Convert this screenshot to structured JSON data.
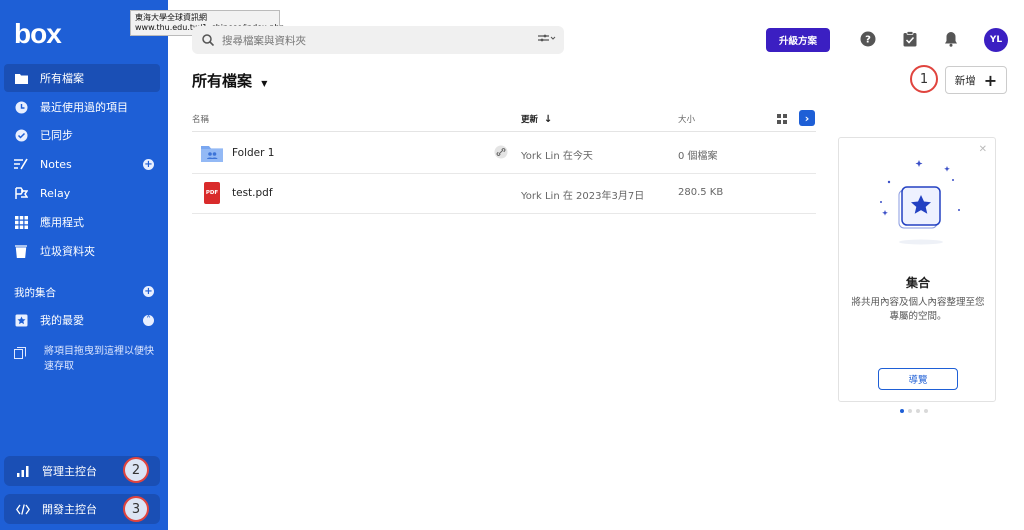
{
  "brand": {
    "logo_text": "box"
  },
  "tooltip": {
    "line1": "東海大學全球資訊網",
    "line2": "www.thu.edu.tw/1_chinese/index.php"
  },
  "sidebar": {
    "items": [
      {
        "label": "所有檔案",
        "icon": "folder-icon"
      },
      {
        "label": "最近使用過的項目",
        "icon": "clock-icon"
      },
      {
        "label": "已同步",
        "icon": "check-circle-icon"
      },
      {
        "label": "Notes",
        "icon": "notes-icon"
      },
      {
        "label": "Relay",
        "icon": "relay-icon"
      },
      {
        "label": "應用程式",
        "icon": "grid-icon"
      },
      {
        "label": "垃圾資料夾",
        "icon": "trash-icon"
      }
    ],
    "collections_label": "我的集合",
    "favorites_label": "我的最愛",
    "drop_hint": "將項目拖曳到這裡以便快速存取",
    "admin_console": "管理主控台",
    "dev_console": "開發主控台"
  },
  "callouts": {
    "one": "1",
    "two": "2",
    "three": "3"
  },
  "header": {
    "search_placeholder": "搜尋檔案與資料夾",
    "upgrade_label": "升級方案",
    "avatar_initials": "YL"
  },
  "main": {
    "title": "所有檔案",
    "new_label": "新增",
    "columns": {
      "name": "名稱",
      "updated": "更新",
      "size": "大小"
    },
    "rows": [
      {
        "name": "Folder 1",
        "updated": "York Lin 在今天",
        "size": "0 個檔案"
      },
      {
        "name": "test.pdf",
        "updated": "York Lin 在 2023年3月7日",
        "size": "280.5 KB"
      }
    ],
    "pdf_badge": "PDF"
  },
  "card": {
    "title": "集合",
    "description": "將共用內容及個人內容整理至您專屬的空間。",
    "button_label": "導覽"
  },
  "colors": {
    "sidebar": "#1e5fd6",
    "accent": "#3b1fc2",
    "callout": "#e0443e"
  }
}
